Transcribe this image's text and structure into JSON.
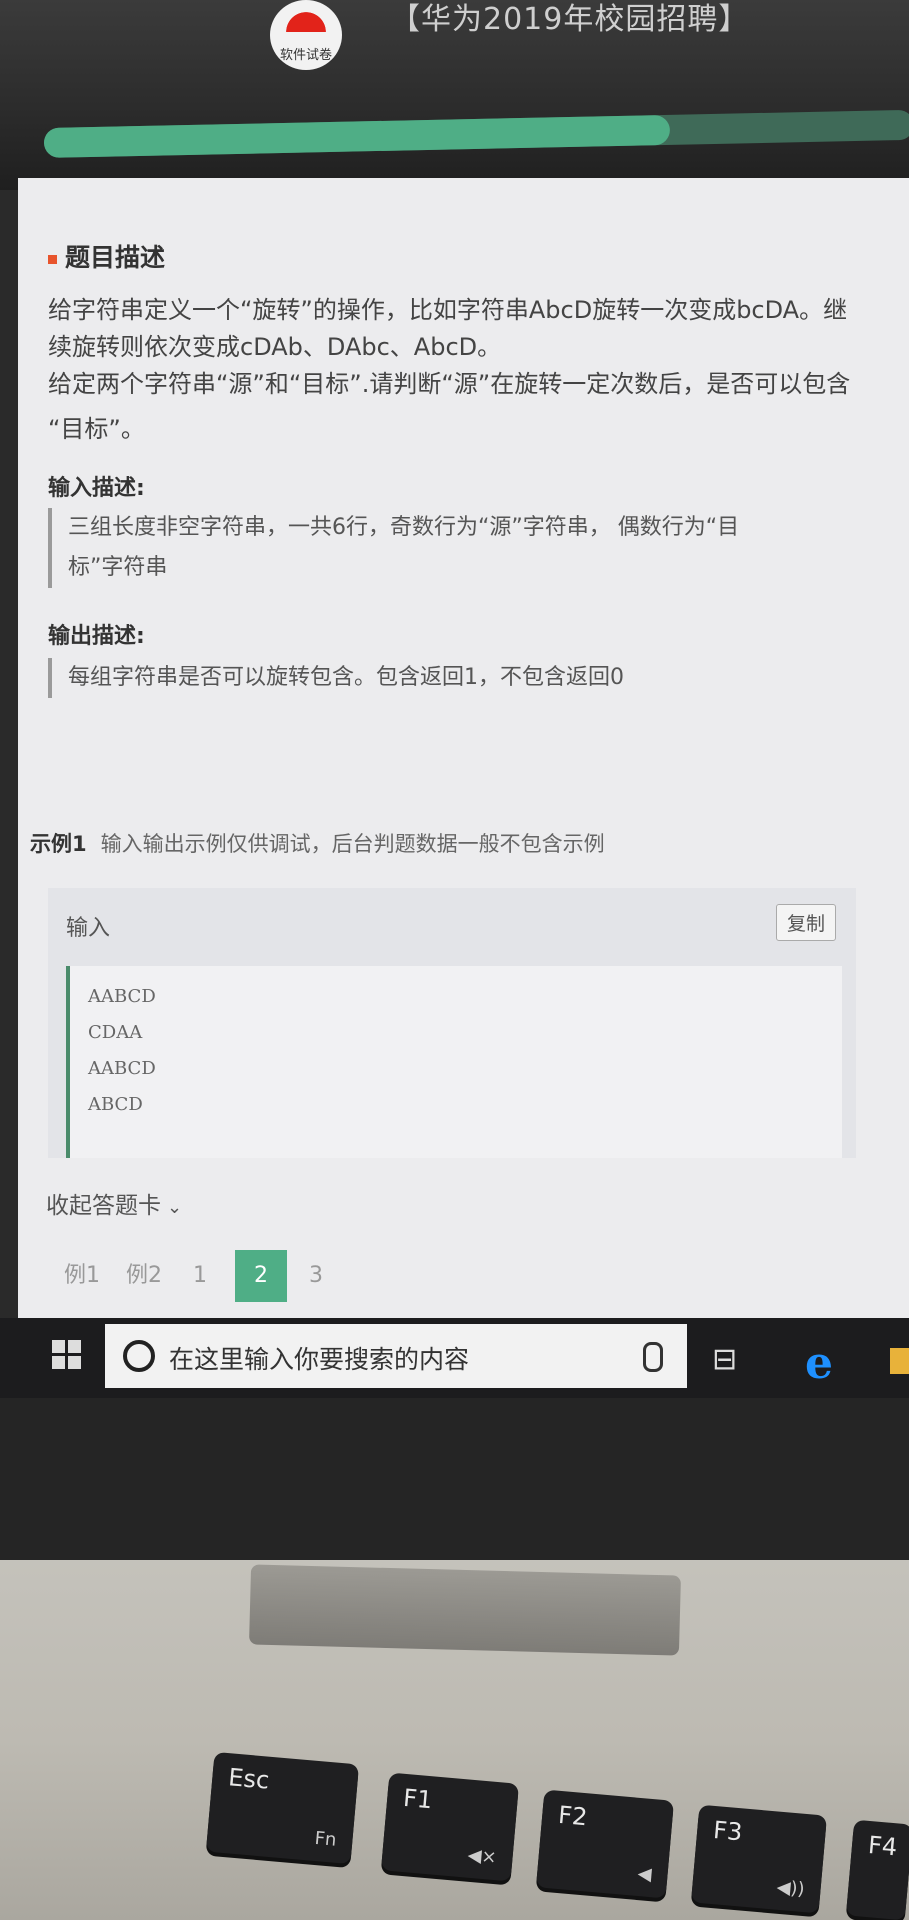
{
  "header": {
    "logo_text": "软件试卷",
    "title": "【华为2019年校园招聘】",
    "progress_fraction": 0.72
  },
  "problem": {
    "heading": "题目描述",
    "description_lines": [
      "给字符串定义一个“旋转”的操作，比如字符串AbcD旋转一次变成bcDA。继",
      "续旋转则依次变成cDAb、DAbc、AbcD。",
      "给定两个字符串“源”和“目标”.请判断“源”在旋转一定次数后，是否可以包含",
      "“目标”。"
    ],
    "input_heading": "输入描述:",
    "input_lines": [
      "三组长度非空字符串，一共6行，奇数行为“源”字符串， 偶数行为“目",
      "标”字符串"
    ],
    "output_heading": "输出描述:",
    "output_text": "每组字符串是否可以旋转包含。包含返回1，不包含返回0"
  },
  "example": {
    "title": "示例1",
    "note": "输入输出示例仅供调试，后台判题数据一般不包含示例",
    "input_label": "输入",
    "copy_label": "复制",
    "input_lines": [
      "AABCD",
      "CDAA",
      "AABCD",
      "ABCD"
    ]
  },
  "answer_card": {
    "fold_label": "收起答题卡",
    "chevron_icon": "chevron-down-icon",
    "items": [
      "例1",
      "例2",
      "1",
      "2",
      "3"
    ],
    "active_index": 3
  },
  "taskbar": {
    "search_placeholder": "在这里输入你要搜索的内容",
    "icons": [
      "windows-start-icon",
      "cortana-circle-icon",
      "microphone-icon",
      "task-view-icon",
      "edge-icon",
      "file-explorer-icon"
    ]
  },
  "keyboard": {
    "keys": [
      {
        "label": "Esc",
        "sub": "Fn"
      },
      {
        "label": "F1",
        "sub": "◀×"
      },
      {
        "label": "F2",
        "sub": "◀"
      },
      {
        "label": "F3",
        "sub": "◀))"
      },
      {
        "label": "F4",
        "sub": ""
      }
    ]
  },
  "colors": {
    "accent_green": "#4fae86",
    "heading_mark": "#e8542c",
    "header_bg": "#2b2b2b"
  }
}
